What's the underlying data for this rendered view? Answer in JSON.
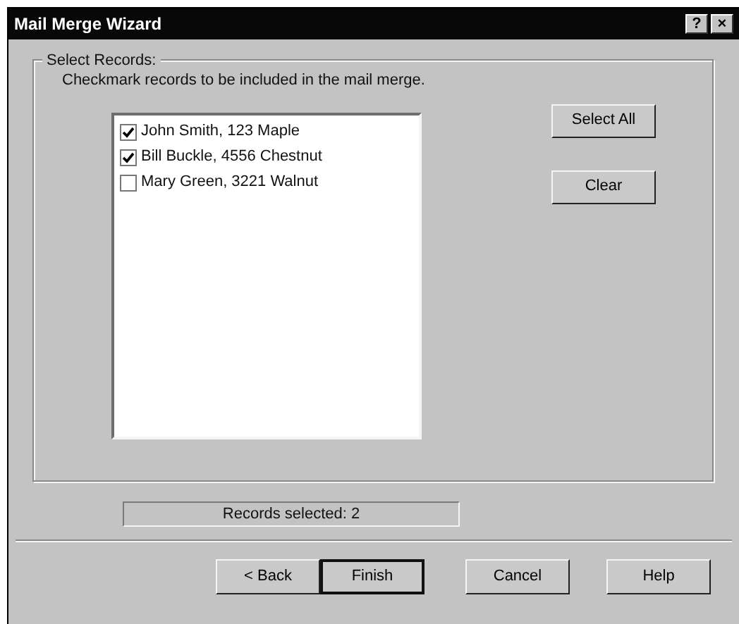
{
  "window": {
    "title": "Mail Merge Wizard",
    "title_buttons": [
      "?",
      "×"
    ]
  },
  "group": {
    "label": "Select Records:",
    "instruction": "Checkmark records to be included in the mail merge."
  },
  "records": [
    {
      "label": "John Smith, 123 Maple",
      "checked": true
    },
    {
      "label": "Bill Buckle, 4556 Chestnut",
      "checked": true
    },
    {
      "label": "Mary Green, 3221 Walnut",
      "checked": false
    }
  ],
  "side_buttons": [
    "Select All",
    "Clear"
  ],
  "status": "Records selected: 2",
  "buttons": [
    {
      "label": "< Back",
      "default": false
    },
    {
      "label": "Finish",
      "default": true
    },
    {
      "label": "Cancel",
      "default": false
    },
    {
      "label": "Help",
      "default": false
    }
  ]
}
